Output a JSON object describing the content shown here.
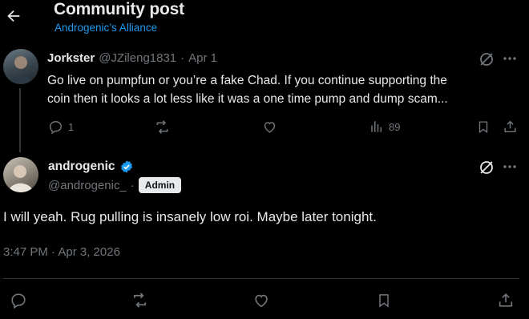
{
  "header": {
    "title": "Community post",
    "community": "Androgenic’s Alliance"
  },
  "reply": {
    "author_name": "Jorkster",
    "handle": "@JZileng1831",
    "separator": "·",
    "date": "Apr 1",
    "text_line1": "Go live on pumpfun or you’re a fake Chad. If you continue supporting the",
    "text_line2": "coin then it looks a lot less like it was a one time pump and dump scam...",
    "reply_count": "1",
    "view_count": "89"
  },
  "main_post": {
    "author_name": "androgenic",
    "handle": "@androgenic_",
    "separator": "·",
    "role_badge": "Admin",
    "text": "I will yeah. Rug pulling is insanely low roi. Maybe later tonight.",
    "timestamp": "3:47 PM · Apr 3, 2026"
  },
  "colors": {
    "background": "#000000",
    "text": "#e7e9ea",
    "muted": "#71767b",
    "accent": "#1d9bf0",
    "verified": "#1d9bf0"
  },
  "icons": {
    "back": "arrow-left-icon",
    "grok": "grok-icon",
    "more": "more-icon",
    "reply": "reply-icon",
    "repost": "repost-icon",
    "like": "heart-icon",
    "views": "views-icon",
    "bookmark": "bookmark-icon",
    "share": "share-icon",
    "verified": "verified-badge-icon"
  }
}
